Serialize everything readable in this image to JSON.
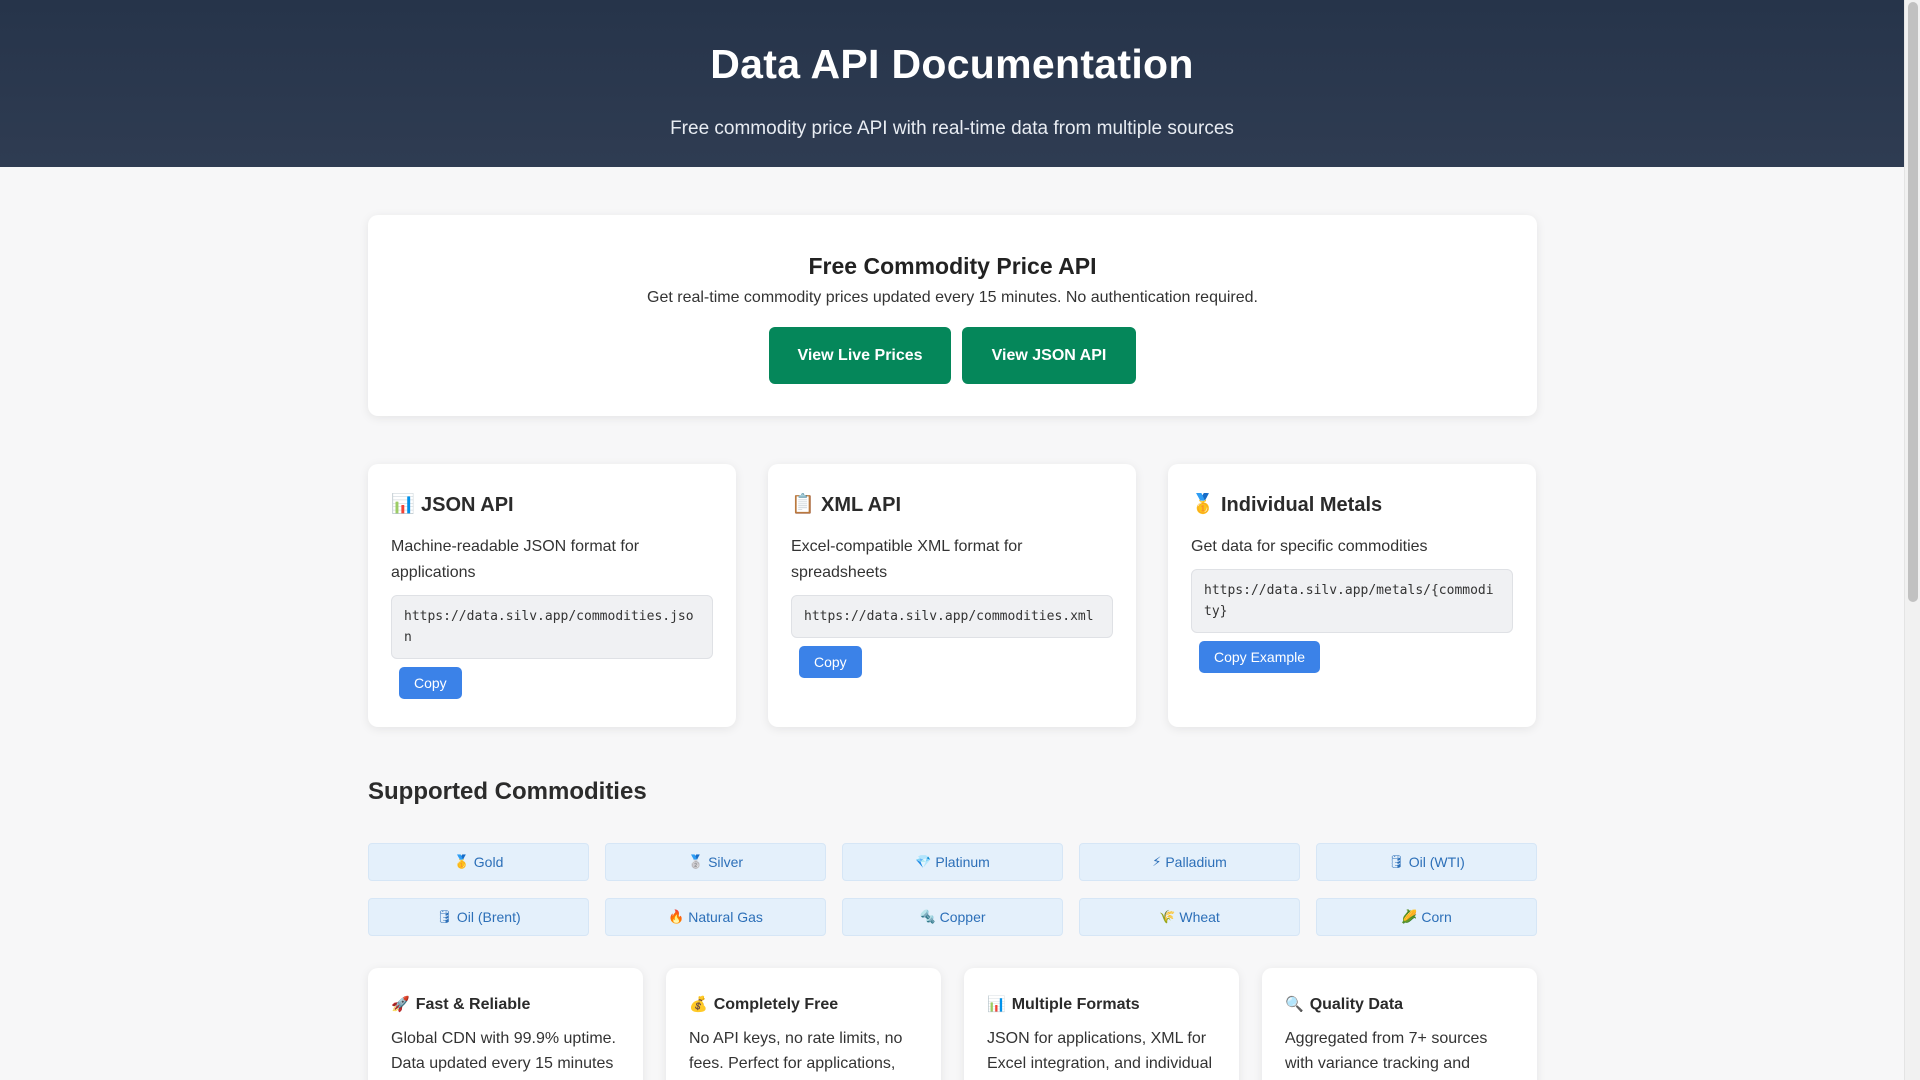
{
  "header": {
    "title": "Data API Documentation",
    "subtitle": "Free commodity price API with real-time data from multiple sources"
  },
  "hero": {
    "title": "Free Commodity Price API",
    "description": "Get real-time commodity prices updated every 15 minutes. No authentication required.",
    "live_button": "View Live Prices",
    "json_button": "View JSON API"
  },
  "api_cards": [
    {
      "icon": "📊",
      "icon_name": "bar-chart-icon",
      "title": "JSON API",
      "description": "Machine-readable JSON format for applications",
      "url": "https://data.silv.app/commodities.json",
      "button": "Copy"
    },
    {
      "icon": "📋",
      "icon_name": "clipboard-icon",
      "title": "XML API",
      "description": "Excel-compatible XML format for spreadsheets",
      "url": "https://data.silv.app/commodities.xml",
      "button": "Copy"
    },
    {
      "icon": "🥇",
      "icon_name": "gold-medal-icon",
      "title": "Individual Metals",
      "description": "Get data for specific commodities",
      "url": "https://data.silv.app/metals/{commodity}",
      "button": "Copy Example"
    }
  ],
  "commodities": {
    "title": "Supported Commodities",
    "items": [
      {
        "icon": "🥇",
        "icon_name": "gold-medal-icon",
        "label": "Gold"
      },
      {
        "icon": "🥈",
        "icon_name": "silver-medal-icon",
        "label": "Silver"
      },
      {
        "icon": "💎",
        "icon_name": "gem-icon",
        "label": "Platinum"
      },
      {
        "icon": "⚡",
        "icon_name": "lightning-icon",
        "label": "Palladium"
      },
      {
        "icon": "🛢",
        "icon_name": "oil-barrel-icon",
        "label": "Oil (WTI)"
      },
      {
        "icon": "🛢",
        "icon_name": "oil-barrel-icon",
        "label": "Oil (Brent)"
      },
      {
        "icon": "🔥",
        "icon_name": "fire-icon",
        "label": "Natural Gas"
      },
      {
        "icon": "🔩",
        "icon_name": "nut-bolt-icon",
        "label": "Copper"
      },
      {
        "icon": "🌾",
        "icon_name": "wheat-icon",
        "label": "Wheat"
      },
      {
        "icon": "🌽",
        "icon_name": "corn-icon",
        "label": "Corn"
      }
    ]
  },
  "features": [
    {
      "icon": "🚀",
      "icon_name": "rocket-icon",
      "title": "Fast & Reliable",
      "text": "Global CDN with 99.9% uptime. Data updated every 15 minutes"
    },
    {
      "icon": "💰",
      "icon_name": "money-bag-icon",
      "title": "Completely Free",
      "text": "No API keys, no rate limits, no fees. Perfect for applications,"
    },
    {
      "icon": "📊",
      "icon_name": "bar-chart-icon",
      "title": "Multiple Formats",
      "text": "JSON for applications, XML for Excel integration, and individual"
    },
    {
      "icon": "🔍",
      "icon_name": "magnifier-icon",
      "title": "Quality Data",
      "text": "Aggregated from 7+ sources with variance tracking and"
    }
  ],
  "colors": {
    "header_bg": "#2a374d",
    "primary_green": "#05875a",
    "primary_blue": "#3b82e8",
    "chip_bg": "#e4f0fb",
    "chip_text": "#2c6fb8"
  }
}
